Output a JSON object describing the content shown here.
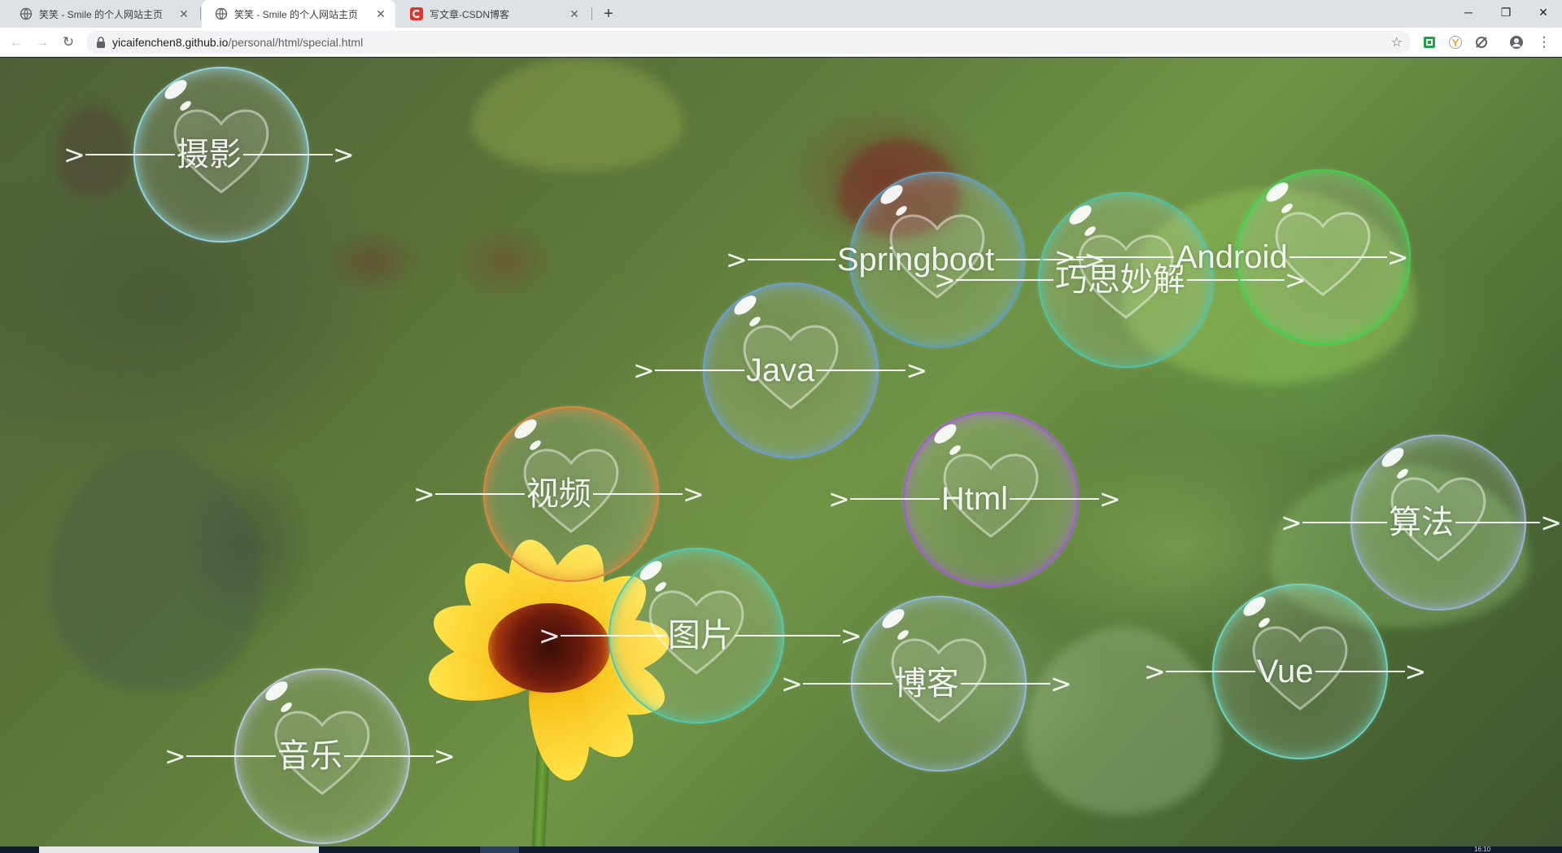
{
  "browser": {
    "tabs": [
      {
        "title": "笑笑 - Smile 的个人网站主页",
        "favicon": "globe-icon",
        "active": false
      },
      {
        "title": "笑笑 - Smile 的个人网站主页",
        "favicon": "globe-icon",
        "active": true
      },
      {
        "title": "写文章-CSDN博客",
        "favicon": "csdn-logo-icon",
        "active": false
      }
    ],
    "new_tab_label": "+",
    "address": {
      "host": "yicaifenchen8.github.io",
      "path": "/personal/html/special.html"
    },
    "window_controls": [
      "minimize-icon",
      "maximize-icon",
      "close-icon"
    ]
  },
  "page": {
    "bubbles": [
      {
        "label": "摄影",
        "rim": "#8fd3e0"
      },
      {
        "label": "Springboot",
        "rim": "#5aa0c8"
      },
      {
        "label": "巧思妙解",
        "rim": "#4fc3a8"
      },
      {
        "label": "Android",
        "rim": "#3fd04a"
      },
      {
        "label": "Java",
        "rim": "#6a9ed8"
      },
      {
        "label": "视频",
        "rim": "#e0843a"
      },
      {
        "label": "Html",
        "rim": "#a25ad6"
      },
      {
        "label": "算法",
        "rim": "#9ab0d8"
      },
      {
        "label": "图片",
        "rim": "#4fcab0"
      },
      {
        "label": "博客",
        "rim": "#8fb8d8"
      },
      {
        "label": "Vue",
        "rim": "#6ad0c0"
      },
      {
        "label": "音乐",
        "rim": "#b8c4d8"
      }
    ],
    "arrow_glyph": ">"
  },
  "taskbar": {
    "clock": "16:10"
  }
}
